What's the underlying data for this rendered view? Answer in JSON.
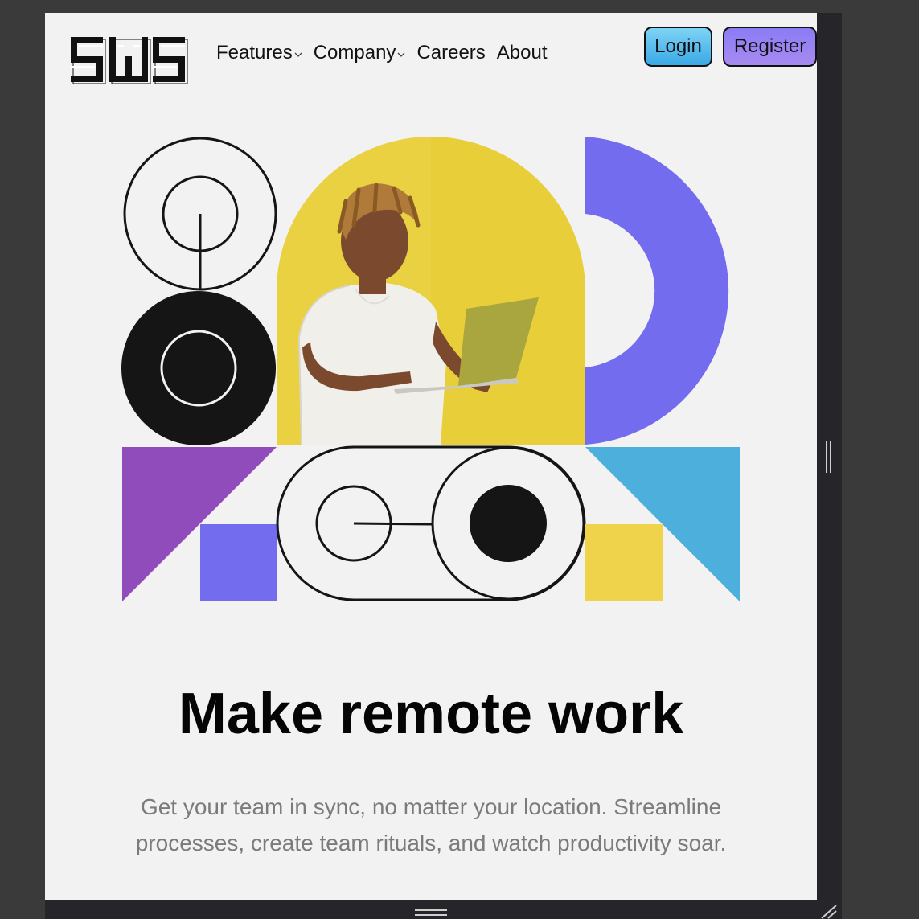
{
  "brand": {
    "logo_text": "SWS"
  },
  "nav": {
    "items": [
      {
        "label": "Features",
        "has_dropdown": true
      },
      {
        "label": "Company",
        "has_dropdown": true
      },
      {
        "label": "Careers",
        "has_dropdown": false
      },
      {
        "label": "About",
        "has_dropdown": false
      }
    ]
  },
  "auth": {
    "login_label": "Login",
    "register_label": "Register"
  },
  "hero": {
    "headline": "Make remote work",
    "subtext": "Get your team in sync, no matter your location. Streamline processes, create team rituals, and watch productivity soar."
  },
  "colors": {
    "page_bg": "#f2f2f2",
    "frame_dark": "#26262a",
    "purple_accent": "#736cee",
    "magenta_accent": "#8f4cba",
    "cyan_accent": "#4db0dc",
    "yellow_accent": "#efd44b",
    "ink": "#151515"
  },
  "icons": [
    "chevron-down-icon",
    "resize-grip-icon",
    "corner-resize-icon"
  ]
}
